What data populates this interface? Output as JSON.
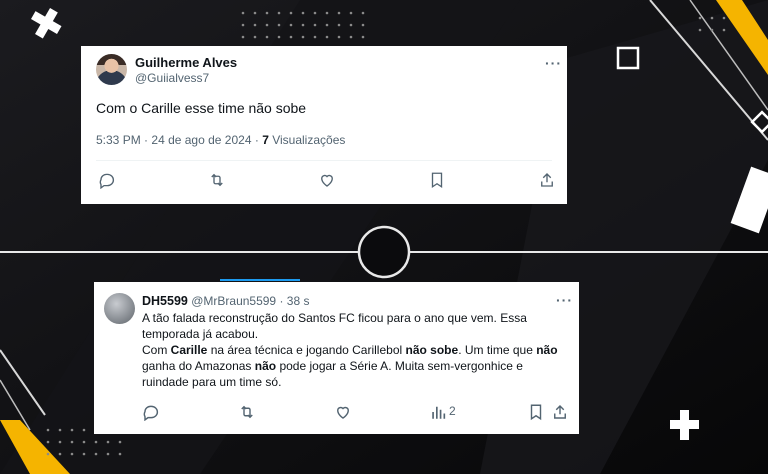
{
  "tweet1": {
    "author_name": "Guilherme Alves",
    "handle": "@Guiialvess7",
    "text": "Com o Carille esse time não sobe",
    "time": "5:33 PM",
    "separator": "·",
    "date": "24 de ago de 2024",
    "views_count": "7",
    "views_label": "Visualizações",
    "more": "···"
  },
  "tweet2": {
    "author_name": "DH5599",
    "handle": "@MrBraun5599",
    "separator": "·",
    "age": "38 s",
    "more": "···",
    "line1": "A tão falada reconstrução do Santos FC ficou para o ano que vem. Essa temporada já acabou.",
    "line2_a": "Com ",
    "line2_b": "Carille",
    "line2_c": " na área técnica e jogando Carillebol ",
    "line2_d": "não sobe",
    "line2_e": ". Um time que ",
    "line2_f": "não",
    "line2_g": " ganha do Amazonas ",
    "line2_h": "não",
    "line2_i": " pode jogar a Série A. Muita sem-vergonhice e ruindade para um time só.",
    "analytics_count": "2"
  },
  "colors": {
    "background": "#0b0b0d",
    "accent_yellow": "#f5b400",
    "card": "#ffffff",
    "muted_text": "#536471"
  }
}
